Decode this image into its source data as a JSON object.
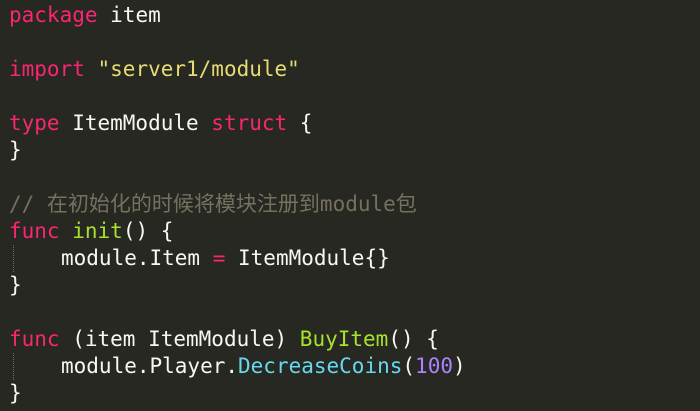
{
  "editor": {
    "line1": {
      "kw": "package",
      "name": " item"
    },
    "line3": {
      "kw": "import",
      "space": " ",
      "path": "\"server1/module\""
    },
    "line5": {
      "kw_type": "type",
      "name": " ItemModule ",
      "kw_struct": "struct",
      "brace": " {"
    },
    "line6": {
      "brace": "}"
    },
    "line8": {
      "comment": "// 在初始化的时候将模块注册到module包"
    },
    "line9": {
      "kw": "func",
      "space": " ",
      "fn": "init",
      "rest": "() {"
    },
    "line10": {
      "left": "module.Item ",
      "op": "=",
      "right": " ItemModule{}"
    },
    "line11": {
      "brace": "}"
    },
    "line13": {
      "kw": "func",
      "receiver": " (item ItemModule) ",
      "fn": "BuyItem",
      "rest": "() {"
    },
    "line14": {
      "prefix": "module.Player.",
      "call": "DecreaseCoins",
      "open": "(",
      "num": "100",
      "close": ")"
    },
    "line15": {
      "brace": "}"
    }
  },
  "colors": {
    "background": "#272822",
    "keyword": "#f92672",
    "string": "#e6db74",
    "function": "#a6e22e",
    "call": "#66d9ef",
    "number": "#ae81ff",
    "comment": "#75715e",
    "text": "#f8f8f2"
  }
}
